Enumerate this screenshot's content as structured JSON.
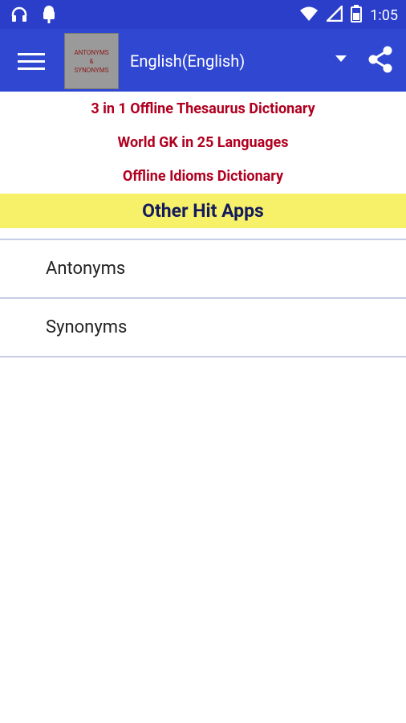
{
  "status_bar": {
    "time": "1:05"
  },
  "app_bar": {
    "logo_line1": "ANTONYMS",
    "logo_line2": "&",
    "logo_line3": "SYNONYMS",
    "language": "English(English)"
  },
  "promo_links": [
    "3 in 1 Offline Thesaurus Dictionary",
    "World GK in 25 Languages",
    "Offline Idioms Dictionary"
  ],
  "banner": "Other Hit Apps",
  "list": [
    "Antonyms",
    "Synonyms"
  ]
}
